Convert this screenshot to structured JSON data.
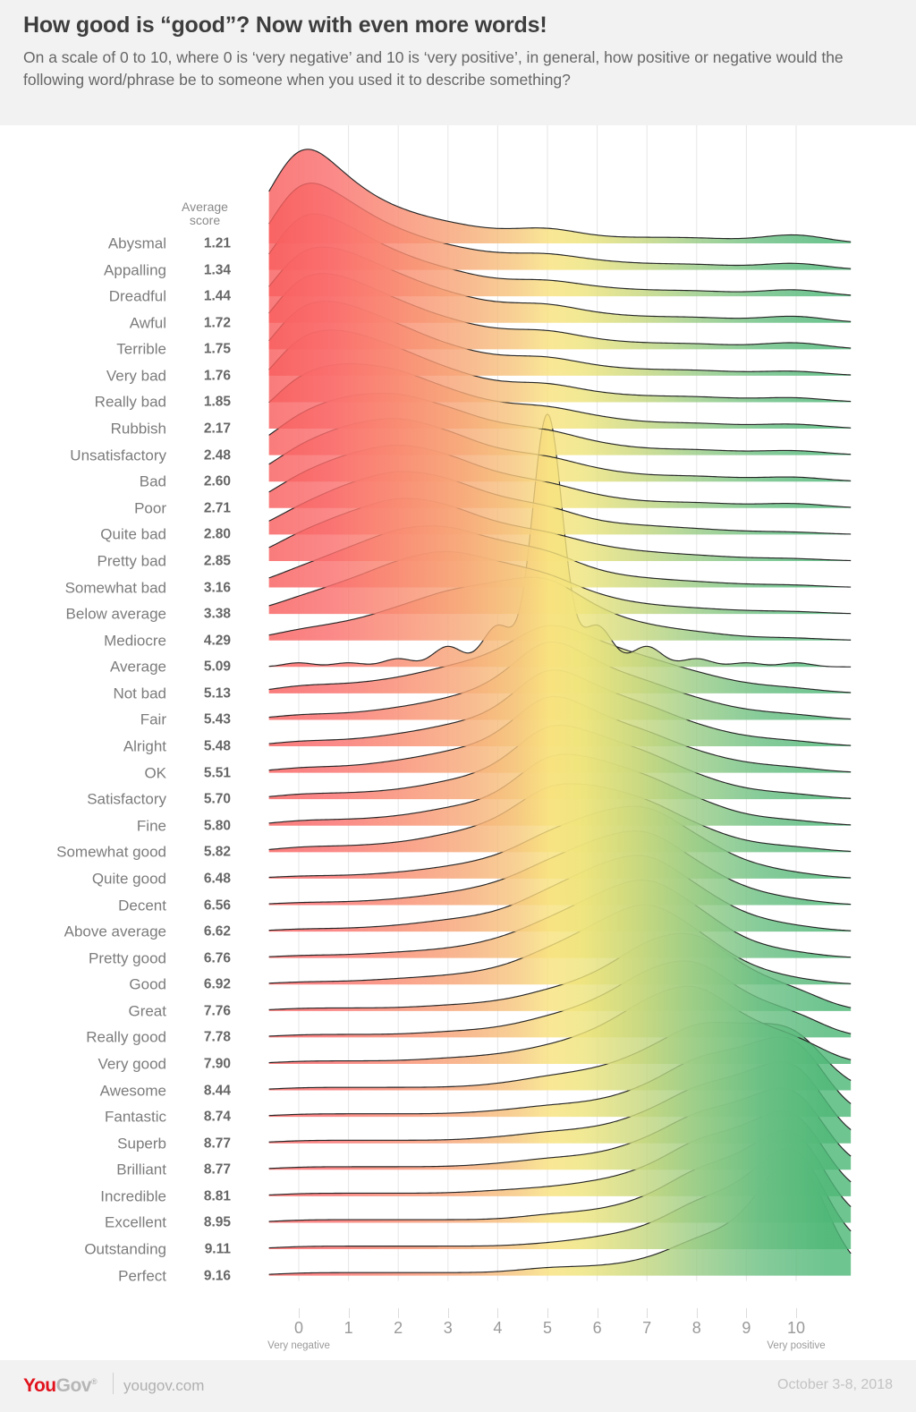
{
  "header": {
    "title": "How good is “good”? Now with even more words!",
    "subtitle": "On a scale of 0 to 10, where 0 is ‘very negative’ and 10 is ‘very positive’, in general, how positive or negative would the following word/phrase be to someone when you used it to describe something?"
  },
  "columns": {
    "average_score_header": "Average\nscore"
  },
  "axis": {
    "ticks": [
      "0",
      "1",
      "2",
      "3",
      "4",
      "5",
      "6",
      "7",
      "8",
      "9",
      "10"
    ],
    "left_end_label": "Very negative",
    "right_end_label": "Very positive"
  },
  "footer": {
    "logo_you": "You",
    "logo_gov": "Gov",
    "site": "yougov.com",
    "date_range": "October 3-8, 2018"
  },
  "colors": {
    "negative": "#fa6e6e",
    "neutral": "#f8e27e",
    "positive": "#63be7b",
    "outline": "#262626",
    "background": "#f2f2f2",
    "plot_background": "#ffffff",
    "gridline": "#e6e6e6",
    "label_text": "#7c7c7c",
    "score_text": "#666666",
    "brand_red": "#e1121c"
  },
  "chart_data": {
    "type": "area",
    "variant": "ridgeline",
    "title": "How good is “good”? Now with even more words!",
    "xlabel": "",
    "ylabel": "",
    "xlim": [
      -0.6,
      11.1
    ],
    "x": [
      0,
      1,
      2,
      3,
      4,
      5,
      6,
      7,
      8,
      9,
      10
    ],
    "grid": true,
    "legend": "none",
    "rows": [
      {
        "label": "Abysmal",
        "average": "1.21",
        "values": [
          41,
          20,
          11,
          7,
          4,
          6,
          2,
          2,
          2,
          1,
          4
        ]
      },
      {
        "label": "Appalling",
        "average": "1.34",
        "values": [
          36,
          22,
          13,
          8,
          5,
          6,
          3,
          2,
          2,
          1,
          3
        ]
      },
      {
        "label": "Dreadful",
        "average": "1.44",
        "values": [
          33,
          23,
          14,
          9,
          5,
          6,
          3,
          2,
          2,
          1,
          3
        ]
      },
      {
        "label": "Awful",
        "average": "1.72",
        "values": [
          28,
          24,
          16,
          10,
          6,
          7,
          3,
          2,
          2,
          1,
          3
        ]
      },
      {
        "label": "Terrible",
        "average": "1.75",
        "values": [
          28,
          24,
          16,
          10,
          6,
          7,
          3,
          2,
          2,
          1,
          3
        ]
      },
      {
        "label": "Very bad",
        "average": "1.76",
        "values": [
          27,
          24,
          17,
          10,
          6,
          7,
          3,
          2,
          2,
          1,
          2
        ]
      },
      {
        "label": "Really bad",
        "average": "1.85",
        "values": [
          25,
          24,
          18,
          11,
          6,
          7,
          3,
          2,
          2,
          1,
          2
        ]
      },
      {
        "label": "Rubbish",
        "average": "2.17",
        "values": [
          20,
          22,
          20,
          13,
          8,
          8,
          4,
          2,
          2,
          1,
          2
        ]
      },
      {
        "label": "Unsatisfactory",
        "average": "2.48",
        "values": [
          15,
          20,
          21,
          16,
          10,
          9,
          4,
          2,
          2,
          1,
          2
        ]
      },
      {
        "label": "Bad",
        "average": "2.60",
        "values": [
          13,
          19,
          22,
          17,
          10,
          9,
          4,
          2,
          2,
          1,
          2
        ]
      },
      {
        "label": "Poor",
        "average": "2.71",
        "values": [
          12,
          18,
          22,
          18,
          11,
          9,
          4,
          2,
          2,
          1,
          2
        ]
      },
      {
        "label": "Quite bad",
        "average": "2.80",
        "values": [
          10,
          17,
          22,
          19,
          12,
          10,
          4,
          3,
          2,
          1,
          1
        ]
      },
      {
        "label": "Pretty bad",
        "average": "2.85",
        "values": [
          10,
          16,
          22,
          19,
          12,
          10,
          5,
          3,
          2,
          1,
          1
        ]
      },
      {
        "label": "Somewhat bad",
        "average": "3.16",
        "values": [
          7,
          13,
          20,
          21,
          15,
          13,
          5,
          3,
          2,
          1,
          1
        ]
      },
      {
        "label": "Below average",
        "average": "3.38",
        "values": [
          6,
          11,
          18,
          22,
          17,
          14,
          6,
          3,
          2,
          1,
          1
        ]
      },
      {
        "label": "Mediocre",
        "average": "4.29",
        "values": [
          4,
          6,
          11,
          17,
          19,
          23,
          10,
          5,
          3,
          1,
          1
        ]
      },
      {
        "label": "Average",
        "average": "5.09",
        "values": [
          1,
          1,
          2,
          5,
          10,
          62,
          10,
          5,
          2,
          1,
          1
        ]
      },
      {
        "label": "Not bad",
        "average": "5.13",
        "values": [
          3,
          3,
          5,
          9,
          13,
          26,
          17,
          12,
          7,
          3,
          2
        ]
      },
      {
        "label": "Fair",
        "average": "5.43",
        "values": [
          2,
          2,
          4,
          7,
          12,
          31,
          18,
          13,
          7,
          3,
          2
        ]
      },
      {
        "label": "Alright",
        "average": "5.48",
        "values": [
          2,
          2,
          4,
          7,
          11,
          30,
          19,
          14,
          7,
          3,
          2
        ]
      },
      {
        "label": "OK",
        "average": "5.51",
        "values": [
          2,
          2,
          4,
          7,
          11,
          30,
          19,
          14,
          7,
          3,
          2
        ]
      },
      {
        "label": "Satisfactory",
        "average": "5.70",
        "values": [
          2,
          2,
          3,
          6,
          10,
          28,
          21,
          16,
          8,
          3,
          2
        ]
      },
      {
        "label": "Fine",
        "average": "5.80",
        "values": [
          2,
          2,
          3,
          6,
          9,
          26,
          22,
          17,
          9,
          3,
          2
        ]
      },
      {
        "label": "Somewhat good",
        "average": "5.82",
        "values": [
          2,
          2,
          3,
          6,
          10,
          24,
          22,
          18,
          9,
          3,
          2
        ]
      },
      {
        "label": "Quite good",
        "average": "6.48",
        "values": [
          1,
          1,
          2,
          4,
          7,
          16,
          22,
          26,
          14,
          5,
          2
        ]
      },
      {
        "label": "Decent",
        "average": "6.56",
        "values": [
          1,
          1,
          2,
          4,
          7,
          15,
          22,
          27,
          14,
          5,
          2
        ]
      },
      {
        "label": "Above average",
        "average": "6.62",
        "values": [
          1,
          1,
          2,
          4,
          6,
          14,
          22,
          28,
          15,
          5,
          2
        ]
      },
      {
        "label": "Pretty good",
        "average": "6.76",
        "values": [
          1,
          1,
          2,
          3,
          6,
          13,
          21,
          29,
          17,
          5,
          2
        ]
      },
      {
        "label": "Good",
        "average": "6.92",
        "values": [
          1,
          1,
          2,
          3,
          5,
          12,
          20,
          30,
          18,
          6,
          2
        ]
      },
      {
        "label": "Great",
        "average": "7.76",
        "values": [
          1,
          1,
          1,
          2,
          3,
          7,
          12,
          24,
          28,
          13,
          8
        ]
      },
      {
        "label": "Really good",
        "average": "7.78",
        "values": [
          1,
          1,
          1,
          2,
          3,
          7,
          12,
          23,
          28,
          13,
          9
        ]
      },
      {
        "label": "Very good",
        "average": "7.90",
        "values": [
          1,
          1,
          1,
          2,
          3,
          6,
          11,
          22,
          29,
          14,
          10
        ]
      },
      {
        "label": "Awesome",
        "average": "8.44",
        "values": [
          1,
          1,
          1,
          1,
          2,
          5,
          7,
          13,
          24,
          21,
          24
        ]
      },
      {
        "label": "Fantastic",
        "average": "8.74",
        "values": [
          1,
          1,
          1,
          1,
          2,
          4,
          5,
          10,
          21,
          22,
          32
        ]
      },
      {
        "label": "Superb",
        "average": "8.77",
        "values": [
          1,
          1,
          1,
          1,
          2,
          4,
          5,
          10,
          20,
          22,
          33
        ]
      },
      {
        "label": "Brilliant",
        "average": "8.77",
        "values": [
          1,
          1,
          1,
          1,
          2,
          4,
          5,
          10,
          20,
          22,
          33
        ]
      },
      {
        "label": "Incredible",
        "average": "8.81",
        "values": [
          1,
          1,
          1,
          1,
          2,
          3,
          5,
          9,
          20,
          22,
          35
        ]
      },
      {
        "label": "Excellent",
        "average": "8.95",
        "values": [
          1,
          1,
          1,
          1,
          1,
          3,
          4,
          8,
          19,
          22,
          39
        ]
      },
      {
        "label": "Outstanding",
        "average": "9.11",
        "values": [
          1,
          1,
          1,
          1,
          1,
          2,
          4,
          7,
          17,
          21,
          44
        ]
      },
      {
        "label": "Perfect",
        "average": "9.16",
        "values": [
          1,
          1,
          1,
          1,
          1,
          3,
          3,
          5,
          13,
          17,
          54
        ]
      }
    ]
  }
}
